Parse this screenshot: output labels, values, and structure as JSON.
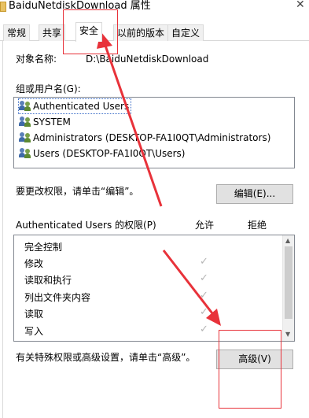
{
  "window": {
    "title": "BaiduNetdiskDownload 属性",
    "close_glyph": "✕"
  },
  "tabs": [
    {
      "label": "常规"
    },
    {
      "label": "共享"
    },
    {
      "label": "安全",
      "active": true
    },
    {
      "label": "以前的版本"
    },
    {
      "label": "自定义"
    }
  ],
  "security": {
    "object_name_label": "对象名称:",
    "object_name_value": "D:\\BaiduNetdiskDownload",
    "group_label": "组或用户名(G):",
    "users": [
      {
        "name": "Authenticated Users",
        "icon": "user-group-icon"
      },
      {
        "name": "SYSTEM",
        "icon": "user-group-icon"
      },
      {
        "name": "Administrators (DESKTOP-FA1I0QT\\Administrators)",
        "icon": "user-group-icon"
      },
      {
        "name": "Users (DESKTOP-FA1I0QT\\Users)",
        "icon": "user-group-icon"
      }
    ],
    "change_hint": "要更改权限，请单击“编辑”。",
    "edit_button": "编辑(E)...",
    "perm_title": "Authenticated Users 的权限(P)",
    "allow_header": "允许",
    "deny_header": "拒绝",
    "permissions": [
      {
        "name": "完全控制",
        "allow": false
      },
      {
        "name": "修改",
        "allow": true
      },
      {
        "name": "读取和执行",
        "allow": true
      },
      {
        "name": "列出文件夹内容",
        "allow": true
      },
      {
        "name": "读取",
        "allow": true
      },
      {
        "name": "写入",
        "allow": true
      }
    ],
    "advanced_hint": "有关特殊权限或高级设置，请单击“高级”。",
    "advanced_button": "高级(V)"
  },
  "colors": {
    "annotation": "#e8323a",
    "check": "#b5b5b5"
  }
}
